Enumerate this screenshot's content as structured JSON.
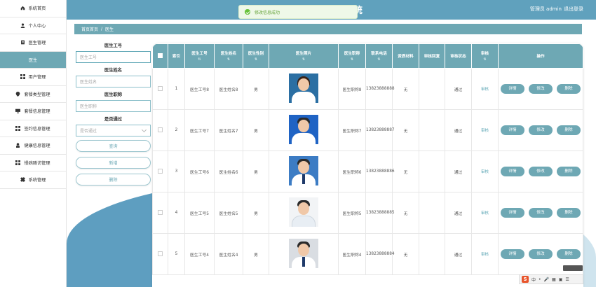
{
  "sidebar": {
    "items": [
      {
        "label": "系统首页",
        "icon": "home-icon"
      },
      {
        "label": "个人中心",
        "icon": "user-icon"
      },
      {
        "label": "医生管理",
        "icon": "doctor-icon"
      },
      {
        "label": "医生",
        "icon": "",
        "active": true
      },
      {
        "label": "用户管理",
        "icon": "grid-icon"
      },
      {
        "label": "套餐类型管理",
        "icon": "pin-icon"
      },
      {
        "label": "套餐信息管理",
        "icon": "monitor-icon"
      },
      {
        "label": "签约信息管理",
        "icon": "grid-icon"
      },
      {
        "label": "健康信息管理",
        "icon": "person-icon"
      },
      {
        "label": "慢病随访管理",
        "icon": "grid-icon"
      },
      {
        "label": "系统管理",
        "icon": "settings-icon"
      }
    ]
  },
  "header": {
    "title": "统",
    "admin_text": "管理员 admin",
    "logout": "退出登录"
  },
  "toast": {
    "message": "修改信息成功"
  },
  "breadcrumb": {
    "home": "首页首页",
    "sep": "/",
    "current": "医生"
  },
  "search": {
    "doctor_no_label": "医生工号",
    "doctor_no_placeholder": "医生工号",
    "doctor_name_label": "医生姓名",
    "doctor_name_placeholder": "医生姓名",
    "doctor_title_label": "医生职称",
    "doctor_title_placeholder": "医生职称",
    "passed_label": "是否通过",
    "passed_placeholder": "是否通过",
    "query_btn": "查询",
    "add_btn": "新增",
    "delete_btn": "删除"
  },
  "table": {
    "headers": {
      "index": "索引",
      "doctor_no": "医生工号",
      "doctor_name": "医生姓名",
      "gender": "医生性别",
      "photo": "医生照片",
      "title": "医生职称",
      "phone": "联系电话",
      "materials": "资质材料",
      "reply": "审核回复",
      "status": "审核状态",
      "audit": "审核",
      "ops": "操作",
      "sort_mark": "⇅"
    },
    "rows": [
      {
        "index": "1",
        "doctor_no": "医生工号8",
        "doctor_name": "医生姓名8",
        "gender": "男",
        "title": "医生职称8",
        "phone": "13823888888",
        "materials": "无",
        "reply": "",
        "status": "通过",
        "audit": "审核",
        "photo": "female-doctor"
      },
      {
        "index": "2",
        "doctor_no": "医生工号7",
        "doctor_name": "医生姓名7",
        "gender": "男",
        "title": "医生职称7",
        "phone": "13823888887",
        "materials": "无",
        "reply": "",
        "status": "通过",
        "audit": "审核",
        "photo": "male-doctor-blue"
      },
      {
        "index": "3",
        "doctor_no": "医生工号6",
        "doctor_name": "医生姓名6",
        "gender": "男",
        "title": "医生职称6",
        "phone": "13823888886",
        "materials": "无",
        "reply": "",
        "status": "通过",
        "audit": "审核",
        "photo": "male-doctor-glasses"
      },
      {
        "index": "4",
        "doctor_no": "医生工号5",
        "doctor_name": "医生姓名5",
        "gender": "男",
        "title": "医生职称5",
        "phone": "13823888885",
        "materials": "无",
        "reply": "",
        "status": "通过",
        "audit": "审核",
        "photo": "male-doctor-white"
      },
      {
        "index": "5",
        "doctor_no": "医生工号4",
        "doctor_name": "医生姓名4",
        "gender": "男",
        "title": "医生职称4",
        "phone": "13823888884",
        "materials": "无",
        "reply": "",
        "status": "通过",
        "audit": "审核",
        "photo": "male-doctor-grey"
      }
    ],
    "op_detail": "详情",
    "op_edit": "修改",
    "op_delete": "删除"
  },
  "ime": {
    "logo": "S",
    "lang": "中"
  },
  "colors": {
    "accent": "#6ea8b4",
    "header": "#60a1bd",
    "toast_bg": "#eef8e8"
  }
}
